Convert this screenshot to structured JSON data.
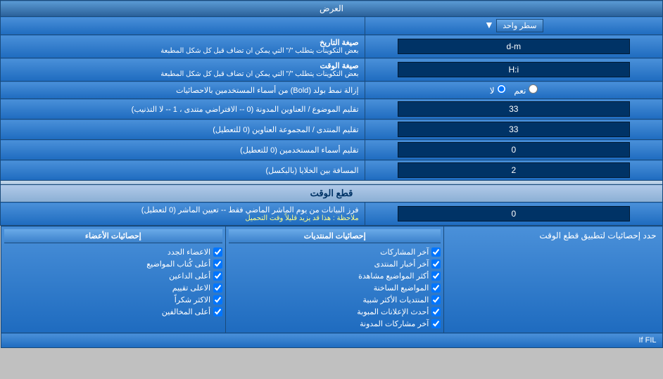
{
  "page": {
    "title": "العرض"
  },
  "rows": [
    {
      "id": "display_mode",
      "label": "العرض",
      "input_type": "dropdown",
      "value": "سطر واحد",
      "colspan": "full"
    },
    {
      "id": "date_format",
      "label": "صيغة التاريخ",
      "sublabel": "بعض التكوينات يتطلب \"/\" التي يمكن ان تضاف قبل كل شكل المطبعة",
      "input_type": "text",
      "value": "d-m"
    },
    {
      "id": "time_format",
      "label": "صيغة الوقت",
      "sublabel": "بعض التكوينات يتطلب \"/\" التي يمكن ان تضاف قبل كل شكل المطبعة",
      "input_type": "text",
      "value": "H:i"
    },
    {
      "id": "bold_remove",
      "label": "إزالة نمط بولد (Bold) من أسماء المستخدمين بالاحصائيات",
      "input_type": "radio",
      "option1": "نعم",
      "option2": "لا",
      "selected": "لا"
    },
    {
      "id": "topic_trim",
      "label": "تقليم الموضوع / العناوين المدونة (0 -- الافتراضي متندى ، 1 -- لا التذنيب)",
      "input_type": "text",
      "value": "33"
    },
    {
      "id": "forum_trim",
      "label": "تقليم المنتدى / المجموعة العناوين (0 للتعطيل)",
      "input_type": "text",
      "value": "33"
    },
    {
      "id": "user_trim",
      "label": "تقليم أسماء المستخدمين (0 للتعطيل)",
      "input_type": "text",
      "value": "0"
    },
    {
      "id": "col_spacing",
      "label": "المسافة بين الخلايا (بالبكسل)",
      "input_type": "text",
      "value": "2"
    }
  ],
  "time_cut_section": {
    "title": "قطع الوقت",
    "cutoff_label": "فرز البيانات من يوم الماشر الماضي فقط -- تعيين الماشر (0 لتعطيل)",
    "cutoff_note": "ملاحظة : هذا قد يزيد قليلاً وقت التحميل",
    "cutoff_value": "0",
    "note_text": "حدد إحصائيات لتطبيق قطع الوقت"
  },
  "stats_cols": [
    {
      "id": "col_right",
      "header": "إحصائيات الأعضاء",
      "items": [
        "الاعضاء الجدد",
        "أعلى كُتاب المواضيع",
        "أعلى الداعين",
        "الاعلى تقييم",
        "الاكثر شكراً",
        "أعلى المخالفين"
      ]
    },
    {
      "id": "col_middle",
      "header": "إحصائيات المنتديات",
      "items": [
        "آخر المشاركات",
        "آخر أخبار المنتدى",
        "أكثر المواضيع مشاهدة",
        "المواضيع الساخنة",
        "المنتديات الأكثر شبية",
        "أحدث الإعلانات المبوبة",
        "آخر مشاركات المدونة"
      ]
    },
    {
      "id": "col_left",
      "header": "",
      "note": "If FIL",
      "items": []
    }
  ]
}
